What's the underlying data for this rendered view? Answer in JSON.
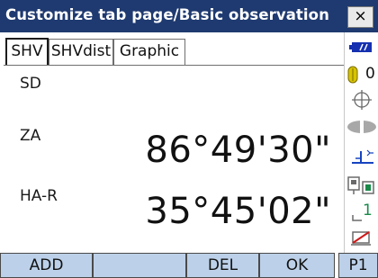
{
  "window": {
    "title": "Customize tab page/Basic observation",
    "close_label": "×"
  },
  "tabs": [
    {
      "label": "SHV",
      "active": true
    },
    {
      "label": "SHVdist",
      "active": false
    },
    {
      "label": "Graphic",
      "active": false
    }
  ],
  "fields": [
    {
      "label": "SD",
      "value": ""
    },
    {
      "label": "ZA",
      "value": "86°49'30\""
    },
    {
      "label": "HA-R",
      "value": "35°45'02\""
    }
  ],
  "status_panel": {
    "battery_icon": "battery-icon",
    "target_count": "0",
    "target_icon": "prism-target-icon",
    "tilt_icon": "tilt-crosshair-icon",
    "laser_icon": "laser-beam-icon",
    "level_icon": "level-indicator-icon",
    "comm_icon": "communication-icon",
    "measure_mode": "1",
    "measure_mode_icon": "measure-mode-icon",
    "input_mode_icon": "input-mode-icon"
  },
  "softkeys": [
    {
      "label": "ADD"
    },
    {
      "label": ""
    },
    {
      "label": "DEL"
    },
    {
      "label": "OK"
    },
    {
      "label": "P1"
    }
  ],
  "colors": {
    "titlebar": "#1f3a70",
    "softkey": "#bcd1e9",
    "battery": "#1530b0",
    "target": "#d8c400",
    "accent_blue": "#1744c0"
  }
}
